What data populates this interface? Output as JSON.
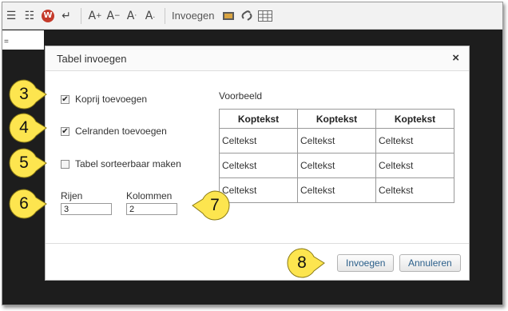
{
  "toolbar": {
    "insert_label": "Invoegen",
    "icons": [
      "bullet-list-icon",
      "numbered-list-icon",
      "wordpress-icon",
      "enter-icon",
      "font-size-up-icon",
      "font-size-down-icon",
      "superscript-icon",
      "subscript-icon",
      "image-icon",
      "link-icon",
      "table-icon"
    ]
  },
  "editor": {
    "marker": "="
  },
  "dialog": {
    "title": "Tabel invoegen",
    "close": "×",
    "options": [
      {
        "label": "Koprij toevoegen",
        "checked": true
      },
      {
        "label": "Celranden toevoegen",
        "checked": true
      },
      {
        "label": "Tabel sorteerbaar maken",
        "checked": false
      }
    ],
    "rows_label": "Rijen",
    "rows_value": "3",
    "cols_label": "Kolommen",
    "cols_value": "2",
    "preview": {
      "label": "Voorbeeld",
      "headers": [
        "Koptekst",
        "Koptekst",
        "Koptekst"
      ],
      "rows": [
        [
          "Celtekst",
          "Celtekst",
          "Celtekst"
        ],
        [
          "Celtekst",
          "Celtekst",
          "Celtekst"
        ],
        [
          "Celtekst",
          "Celtekst",
          "Celtekst"
        ]
      ]
    },
    "buttons": {
      "insert": "Invoegen",
      "cancel": "Annuleren"
    }
  },
  "callouts": [
    "3",
    "4",
    "5",
    "6",
    "7",
    "8"
  ],
  "colors": {
    "callout_fill": "#fde54f",
    "callout_stroke": "#8a7a16",
    "button_text": "#2b5f8a",
    "backdrop": "#1d1d1d"
  }
}
